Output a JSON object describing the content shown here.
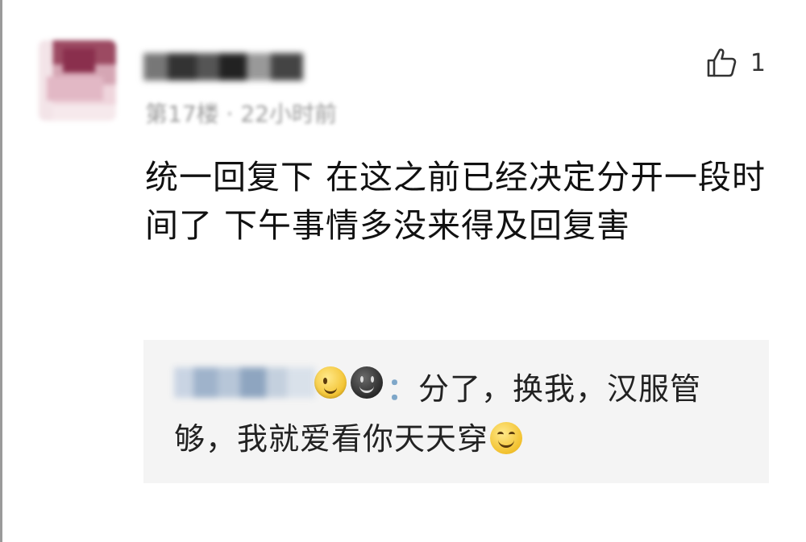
{
  "comment": {
    "author_name": "",
    "meta": "第17楼 · 22小时前",
    "like_count": "1",
    "text": "统一回复下 在这之前已经决定分开一段时间了 下午事情多没来得及回复害"
  },
  "reply": {
    "author_name": "",
    "colon": "：",
    "text": "分了，换我，汉服管够，我就爱看你天天穿",
    "emojis": [
      "wink-emoji",
      "dark-smile-emoji",
      "smile-emoji"
    ]
  },
  "colors": {
    "background": "#ffffff",
    "reply_background": "#f4f4f4",
    "meta_text": "#9a9a9a",
    "reply_colon": "#7ea7c9"
  },
  "icons": {
    "like": "thumbs-up-icon"
  }
}
